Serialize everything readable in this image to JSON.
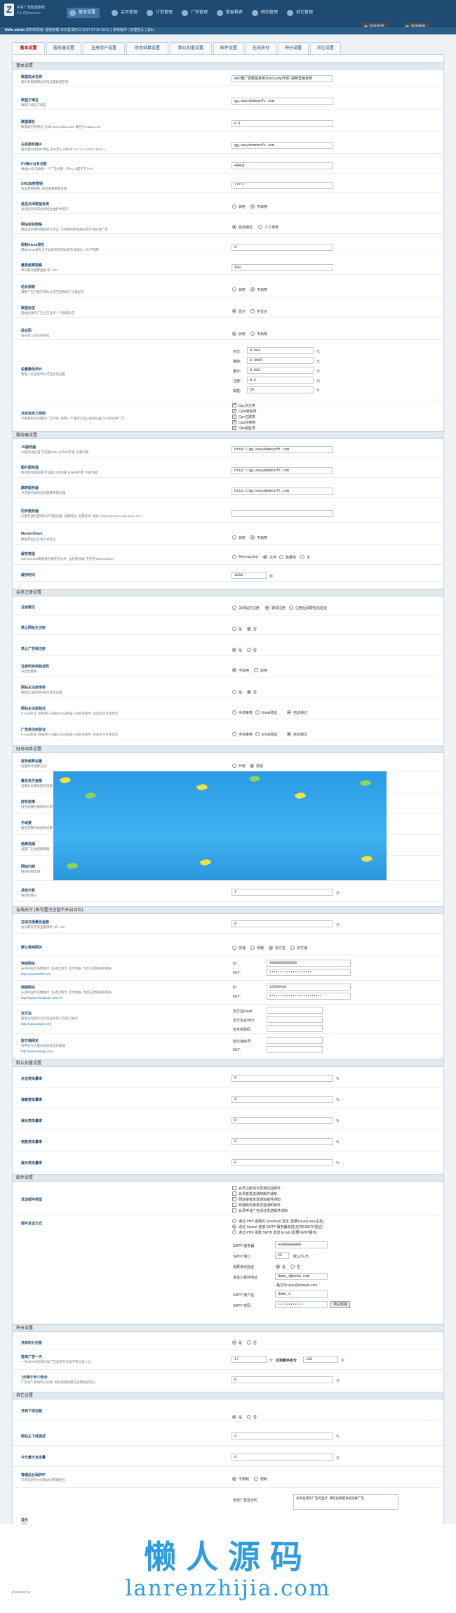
{
  "header": {
    "brand_line1": "中青广告联盟系统",
    "brand_line2": "2.5 ZQtaw.com",
    "nav": [
      {
        "label": "基本设置"
      },
      {
        "label": "会员管理"
      },
      {
        "label": "计划管理"
      },
      {
        "label": "广告管理"
      },
      {
        "label": "数据报表"
      },
      {
        "label": "网站管理"
      },
      {
        "label": "其它管理"
      }
    ],
    "right_buttons": [
      {
        "label": "财务管理"
      },
      {
        "label": "快速通道"
      }
    ],
    "subbar_prefix": "Hello admin",
    "subbar_text": "您的权限组: 超级管理 本次登录时间 2017-07-26 09:51 [ 系统操作 | 管理首页 ] 退出"
  },
  "tabs": [
    {
      "label": "基本设置"
    },
    {
      "label": "服务器设置"
    },
    {
      "label": "注册用户设置"
    },
    {
      "label": "财务结算设置"
    },
    {
      "label": "数认扣量设置"
    },
    {
      "label": "邮件设置"
    },
    {
      "label": "在线支付"
    },
    {
      "label": "积分设置"
    },
    {
      "label": "其它设置"
    }
  ],
  "sections": {
    "basic": "基本设置",
    "server": "服务器设置",
    "member": "会员注册设置",
    "finance": "财务结算设置",
    "payment": "在线支付 (帐号置为空暂不开启对应)",
    "deduct": "默认扣量设置",
    "mail": "邮件设置",
    "points": "积分设置",
    "other": "其它设置"
  },
  "basic": {
    "site_name": {
      "label": "联盟站点名称",
      "desc": "暂时有联盟网站名称设置联盟名称",
      "value": "ABC聚广告联盟系统2016|php开源|视频营销系统"
    },
    "site_subtitle": {
      "label": "联盟子域名",
      "desc": "联盟子域名子域名",
      "value": "gg.easydomesoft.com"
    },
    "domain": {
      "label": "联盟域名",
      "desc": "联盟域名的网址, 比如 www.zqtaw.com 域名为 zqtaw.com",
      "value": "0.1"
    },
    "server_ip": {
      "label": "主机服务器IP",
      "desc": "服务器的主机IP地址 多IP用 | 分隔 如: 127.0.0.1|192.168.1.1",
      "value": "gg.easydomesoft.com"
    },
    "pv_interval": {
      "label": "PV统计分多次数",
      "desc": "根据PV的次数每一个广告计算一次PV, 0属于不计PV",
      "value": "40MUX"
    },
    "ssl_key": {
      "label": "SMS加密密钥",
      "desc": "安全密钥密钥, 改动后要重新生成",
      "value": "*****"
    },
    "site_close": {
      "label": "是否关闭联盟系统",
      "desc": "关闭后系统前台将给出维护中提示",
      "options": [
        "启用",
        "不启用"
      ],
      "selected": 1
    },
    "site_audit": {
      "label": "网站审核策略",
      "desc": "网站主新增的网站默认状态, 只有网站审核通过后才能投放广告",
      "options": [
        "自动通过",
        "人工审核"
      ],
      "selected": 0
    },
    "reg_limit": {
      "label": "限制Alexa排名",
      "desc": "网站Alexa排名大于此排名的网站将无法通过, 0为不限制",
      "value": "0"
    },
    "min_cash": {
      "label": "最高结算限额",
      "desc": "单日最高结算金额 如: 100",
      "value": "100"
    },
    "ad_check": {
      "label": "站长限制",
      "desc": "限制广告只能在网站主提交的网站下才能显示",
      "options": [
        "启用",
        "不启用"
      ],
      "selected": 1
    },
    "referrer": {
      "label": "联盟标志",
      "desc": "网站投放的广告上方显示一个联盟标志",
      "options": [
        "显示",
        "不显示"
      ],
      "selected": 0
    },
    "verify_code": {
      "label": "验证码",
      "desc": "会员登入验证码开启",
      "options": [
        "启用",
        "不启用"
      ],
      "selected": 0
    },
    "price_settings": {
      "label": "设置最低单价",
      "desc": "管理人员当前单价可在此处设置",
      "items": [
        {
          "name": "点击:",
          "value": "0.004",
          "unit": "元"
        },
        {
          "name": "弹窗:",
          "value": "0.0065",
          "unit": "元"
        },
        {
          "name": "展示:",
          "value": "0.002",
          "unit": "元"
        },
        {
          "name": "注册:",
          "value": "0.2",
          "unit": "元"
        },
        {
          "name": "销售:",
          "value": "20",
          "unit": "%"
        }
      ]
    },
    "ad_display": {
      "label": "开启自定义规则",
      "desc": "不需要担动太慢的广告代码, 采用一个直接方式让投放设置CDN的效果广告",
      "options": [
        "Cpc点击类",
        "Cpm弹窗类",
        "Cpv注展类",
        "Cpa注册类",
        "Cps销售类"
      ]
    }
  },
  "server": {
    "js_server": {
      "label": "JS服务器",
      "desc": "JS服务器设置 可设置CDN 分布式存储, 负载均衡",
      "value": "http://gg.easydomesoft.com"
    },
    "img_server": {
      "label": "图片服务器",
      "desc": "图片服务器设置 可设置CDN加速 分布式存储, 负载均衡",
      "value": "http://gg.easydomesoft.com"
    },
    "click_server": {
      "label": "跳转服务器",
      "desc": "点击服务器地址设置跳转服务器",
      "value": "http://gg.easydomesoft.com"
    },
    "sync_server": {
      "label": "同步服务器",
      "desc": "多服务器时使用同步的服务器, 设置域名, 设置格式, 格式:code.php.com,code.php.com+",
      "value": ""
    },
    "master_slave": {
      "label": "Master/Slave",
      "desc": "数据库主从分离方式开启",
      "options": [
        "启用",
        "不启用"
      ],
      "selected": 1
    },
    "cache_type": {
      "label": "缓存类型",
      "desc": "Memcached需要服务器支持文件, 当前服务器: 不支持 Memcached",
      "options": [
        "Memcached",
        "文件",
        "数据库",
        "无"
      ],
      "selected": 1
    },
    "cache_time": {
      "label": "缓存时间",
      "value": "1800",
      "unit": "秒"
    }
  },
  "member": {
    "reg_mode": {
      "label": "注册模式",
      "options": [
        "关闭站内注册",
        "邀请注册",
        "注册后需要短信验证"
      ],
      "selected": 1
    },
    "site_reg": {
      "label": "禁止网站主注册",
      "options": [
        "是",
        "否"
      ],
      "selected": 1
    },
    "adv_reg": {
      "label": "禁止广告商注册",
      "options": [
        "是",
        "否"
      ],
      "selected": 0
    },
    "reg_code": {
      "label": "注册时启用验证码",
      "desc": "开启后需要",
      "options": [
        "不启用",
        "启用"
      ],
      "selected": 0
    },
    "site_audit": {
      "label": "网站主注册审核",
      "desc": "网站主注册后的账号激活设置",
      "options": [
        "是",
        "否"
      ],
      "selected": 0
    },
    "site_verify": {
      "label": "网站主注册验证",
      "desc": "E-mail验证: 网站用户注册 Email发送一封验证邮件, 验证后才有效激活",
      "options": [
        "手动审核",
        "Email验证",
        "自动通过"
      ],
      "selected": 2
    },
    "adv_verify": {
      "label": "广告商注册验证",
      "desc": "E-mail验证: 网站用户注册 Email发送一封验证邮件, 验证后才有效激活",
      "options": [
        "手动审核",
        "Email验证",
        "自动通过"
      ],
      "selected": 2
    }
  },
  "finance": {
    "settle_mode": {
      "label": "财务结算设置",
      "desc": "设置财务结算方式",
      "options": [
        "日结",
        "周结"
      ],
      "selected": 1
    },
    "min_pay": {
      "label": "最低支付金额",
      "desc": "设置站长最低提现金额"
    },
    "finance_fee": {
      "label": "财务税率",
      "desc": "财务结算时扣除的比率"
    },
    "manual": {
      "label": "手续费",
      "desc": "财务结算时扣除手续费"
    },
    "settle_cycle": {
      "label": "结算周期",
      "desc": "设置广告主结算周期"
    },
    "site_cycle": {
      "label": "网站归档",
      "desc": "网站归档周期"
    },
    "month_days": {
      "label": "月结天数",
      "desc": "每月结算日",
      "value": "7",
      "unit": "天"
    }
  },
  "payment": {
    "min_recharge": {
      "label": "在线充值最低金额",
      "desc": "会员最低充值金额限制, 如: 100",
      "value": "0",
      "unit": "元"
    },
    "default_gateway": {
      "label": "默认使用网关",
      "options": [
        "快钱",
        "网银",
        "支付宝",
        "财付通"
      ],
      "selected": 2
    },
    "alipay": {
      "label": "快钱网关",
      "desc": "支持中国大多数银行, 包括信用卡, 实时到帐, 为您方便快速的网关",
      "link": "http://www.99bill.com",
      "fields": [
        {
          "name": "ID:",
          "value": "4399999999999"
        },
        {
          "name": "KEY:",
          "value": "••••••••••••••••••••"
        }
      ]
    },
    "chinapay": {
      "label": "网银网关",
      "desc": "支持中国大多数银行, 包括信用卡, 实时到帐, 为您方便快速的网关",
      "link": "http://www.chinabank.com.cn",
      "fields": [
        {
          "name": "ID:",
          "value": "22060418"
        },
        {
          "name": "KEY:",
          "value": "•••••••••••••••••••••••••"
        }
      ]
    },
    "alipay2": {
      "label": "支付宝",
      "desc": "最低出现显示支付宝业务第三方接口服务",
      "link": "http://www.alipay.com",
      "fields": [
        {
          "name": "支付宝Email:",
          "value": ""
        },
        {
          "name": "支付宝合作ID:",
          "value": ""
        },
        {
          "name": "安全校验码:",
          "value": ""
        }
      ]
    },
    "tenpay": {
      "label": "财付通网关",
      "desc": "采用业务大量投放商家支付渠道",
      "link": "http://www.tenpay.com",
      "fields": [
        {
          "name": "财付通商号:",
          "value": ""
        },
        {
          "name": "KEY:",
          "value": ""
        }
      ]
    }
  },
  "deduct": {
    "items": [
      {
        "label": "点击类扣量率",
        "value": "5",
        "unit": "%"
      },
      {
        "label": "弹窗类扣量率",
        "value": "0",
        "unit": "%"
      },
      {
        "label": "展示类扣量率",
        "value": "0",
        "unit": "%"
      },
      {
        "label": "销售类扣量率",
        "value": "0",
        "unit": "%"
      },
      {
        "label": "展示类扣量率",
        "value": "0",
        "unit": "%"
      }
    ]
  },
  "mail": {
    "send_mail": {
      "label": "发送邮件类型",
      "options": [
        "会员注册成功发送欢迎邮件",
        "会员者发送通知邮件通知",
        "网站审核发送通知邮件通知",
        "新建新的审核发送通知邮件",
        "会员申请广告通过发送邮件通知"
      ]
    },
    "mail_mode": {
      "label": "邮件发送方式",
      "options": [
        "通过 PHP 函数的 Sendmail 发送 (需要Linux/Linux主机)",
        "通过 Socket 连接 SMTP 服务器发送(支持ESMTP验证)",
        "通过 PHP 函数 SMTP 发送 Email (需要SMTP服务)"
      ],
      "selected": 1,
      "fields": [
        {
          "name": "SMTP 服务器",
          "value": "43999999999"
        },
        {
          "name": "SMTP 端口",
          "value": "25",
          "note": "默认为 25"
        },
        {
          "name": "需要身份验证",
          "options": [
            "是",
            "否"
          ],
          "selected": 0
        },
        {
          "name": "发信人邮件地址",
          "value": "demo_s@ezhu.com",
          "note": "格式为:user@domain.com"
        },
        {
          "name": "SMTP 用户名",
          "value": "demo_s"
        },
        {
          "name": "SMTP 密码",
          "value": "••••••••••••"
        }
      ],
      "test_button": "测试连接"
    }
  },
  "points": {
    "open_points": {
      "label": "开启积分功能",
      "options": [
        "是",
        "否"
      ],
      "selected": 0
    },
    "points_rate": {
      "label": "签到广告一天",
      "desc": "一天5时4时间的时候广告发布任务给予积分多少分",
      "value": "17",
      "unit": "分",
      "label2": "达到最多积分",
      "value2": "100",
      "unit2": "次"
    },
    "points_more": {
      "label": "1元等于多少积分",
      "desc": "广告给人预估积分兑换, 财务管理等需在此转换成积分",
      "value": "0",
      "unit": "分"
    }
  },
  "other": {
    "cache_open": {
      "label": "开启下线功能",
      "options": [
        "是",
        "否"
      ],
      "selected": 0
    },
    "site_max": {
      "label": "网站主下线提成",
      "value": "2",
      "unit": "%"
    },
    "today_exc": {
      "label": "今日最大点击量",
      "value": "0",
      "unit": "次"
    },
    "admin_protect": {
      "label": "管理后台保护IP",
      "desc": "只有指定的IP才能访问管理后台",
      "options": [
        "不限制",
        "限制"
      ],
      "selected": 0
    },
    "no_ad": {
      "label": "无效广告显示的",
      "value": "没有合适的广告可显示, 请前往联盟系统选择广告"
    },
    "last_label": "显示",
    "last_desc": "广告"
  },
  "watermark": {
    "cn": "懒人源码",
    "en": "lanrenzhijia.com"
  },
  "footer": "Powered by"
}
